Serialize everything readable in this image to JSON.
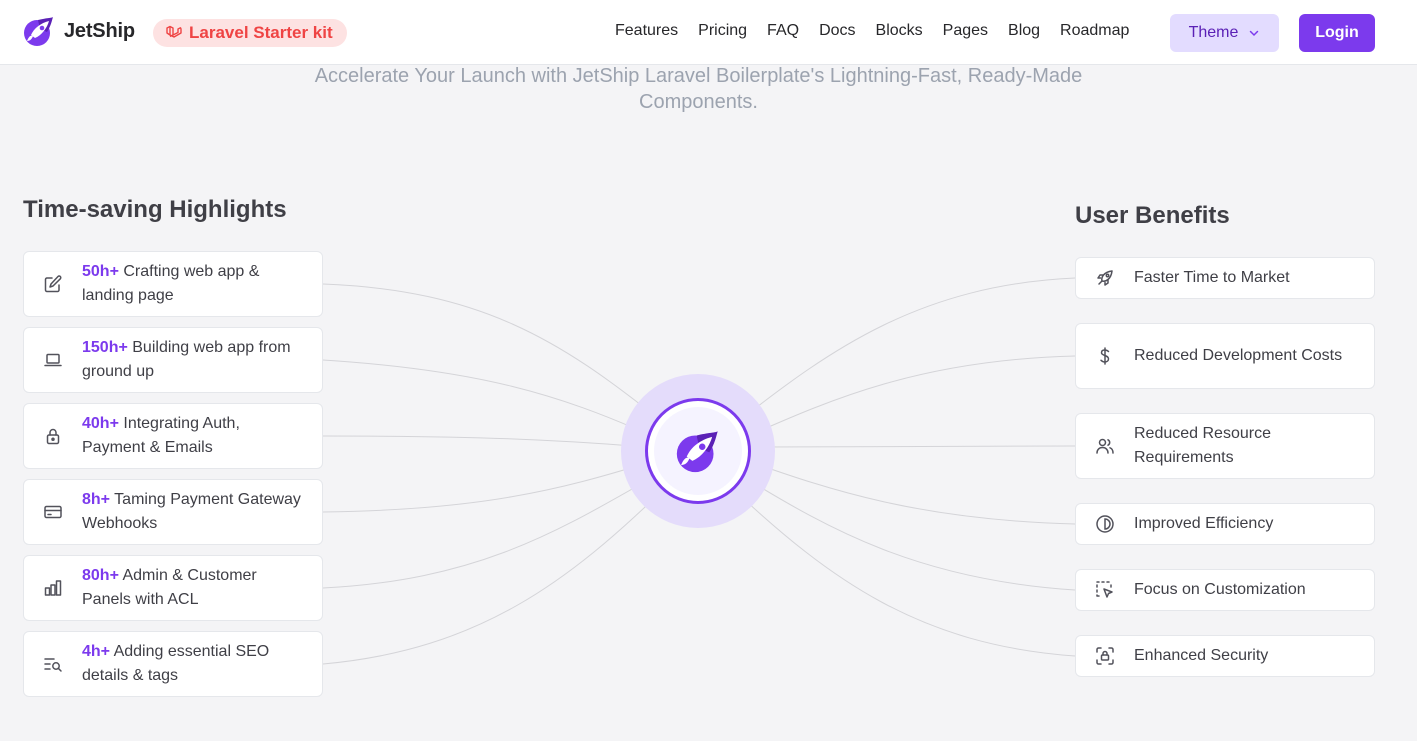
{
  "header": {
    "brand": "JetShip",
    "badge": "Laravel Starter kit",
    "nav": [
      "Features",
      "Pricing",
      "FAQ",
      "Docs",
      "Blocks",
      "Pages",
      "Blog",
      "Roadmap"
    ],
    "theme_label": "Theme",
    "login_label": "Login"
  },
  "hero": {
    "subtitle": "Accelerate Your Launch with JetShip Laravel Boilerplate's Lightning-Fast, Ready-Made Components."
  },
  "highlights": {
    "title": "Time-saving Highlights",
    "items": [
      {
        "hours": "50h+",
        "text": " Crafting web app & landing page",
        "icon": "pencil-icon"
      },
      {
        "hours": "150h+",
        "text": " Building web app from ground up",
        "icon": "laptop-icon"
      },
      {
        "hours": "40h+",
        "text": " Integrating Auth, Payment & Emails",
        "icon": "lock-icon"
      },
      {
        "hours": "8h+",
        "text": " Taming Payment Gateway Webhooks",
        "icon": "credit-card-icon"
      },
      {
        "hours": "80h+",
        "text": " Admin & Customer Panels with ACL",
        "icon": "bar-chart-icon"
      },
      {
        "hours": "4h+",
        "text": " Adding essential SEO details & tags",
        "icon": "text-search-icon"
      }
    ]
  },
  "benefits": {
    "title": "User Benefits",
    "items": [
      {
        "label": "Faster Time to Market",
        "icon": "rocket-icon"
      },
      {
        "label": "Reduced Development Costs",
        "icon": "dollar-icon"
      },
      {
        "label": "Reduced Resource Requirements",
        "icon": "users-icon"
      },
      {
        "label": "Improved Efficiency",
        "icon": "half-circle-icon"
      },
      {
        "label": "Focus on Customization",
        "icon": "pointer-select-icon"
      },
      {
        "label": "Enhanced Security",
        "icon": "scan-lock-icon"
      }
    ]
  },
  "colors": {
    "accent": "#7c3aed",
    "badge_text": "#ef4444",
    "badge_bg": "#fde2e2",
    "background": "#f4f4f6"
  }
}
